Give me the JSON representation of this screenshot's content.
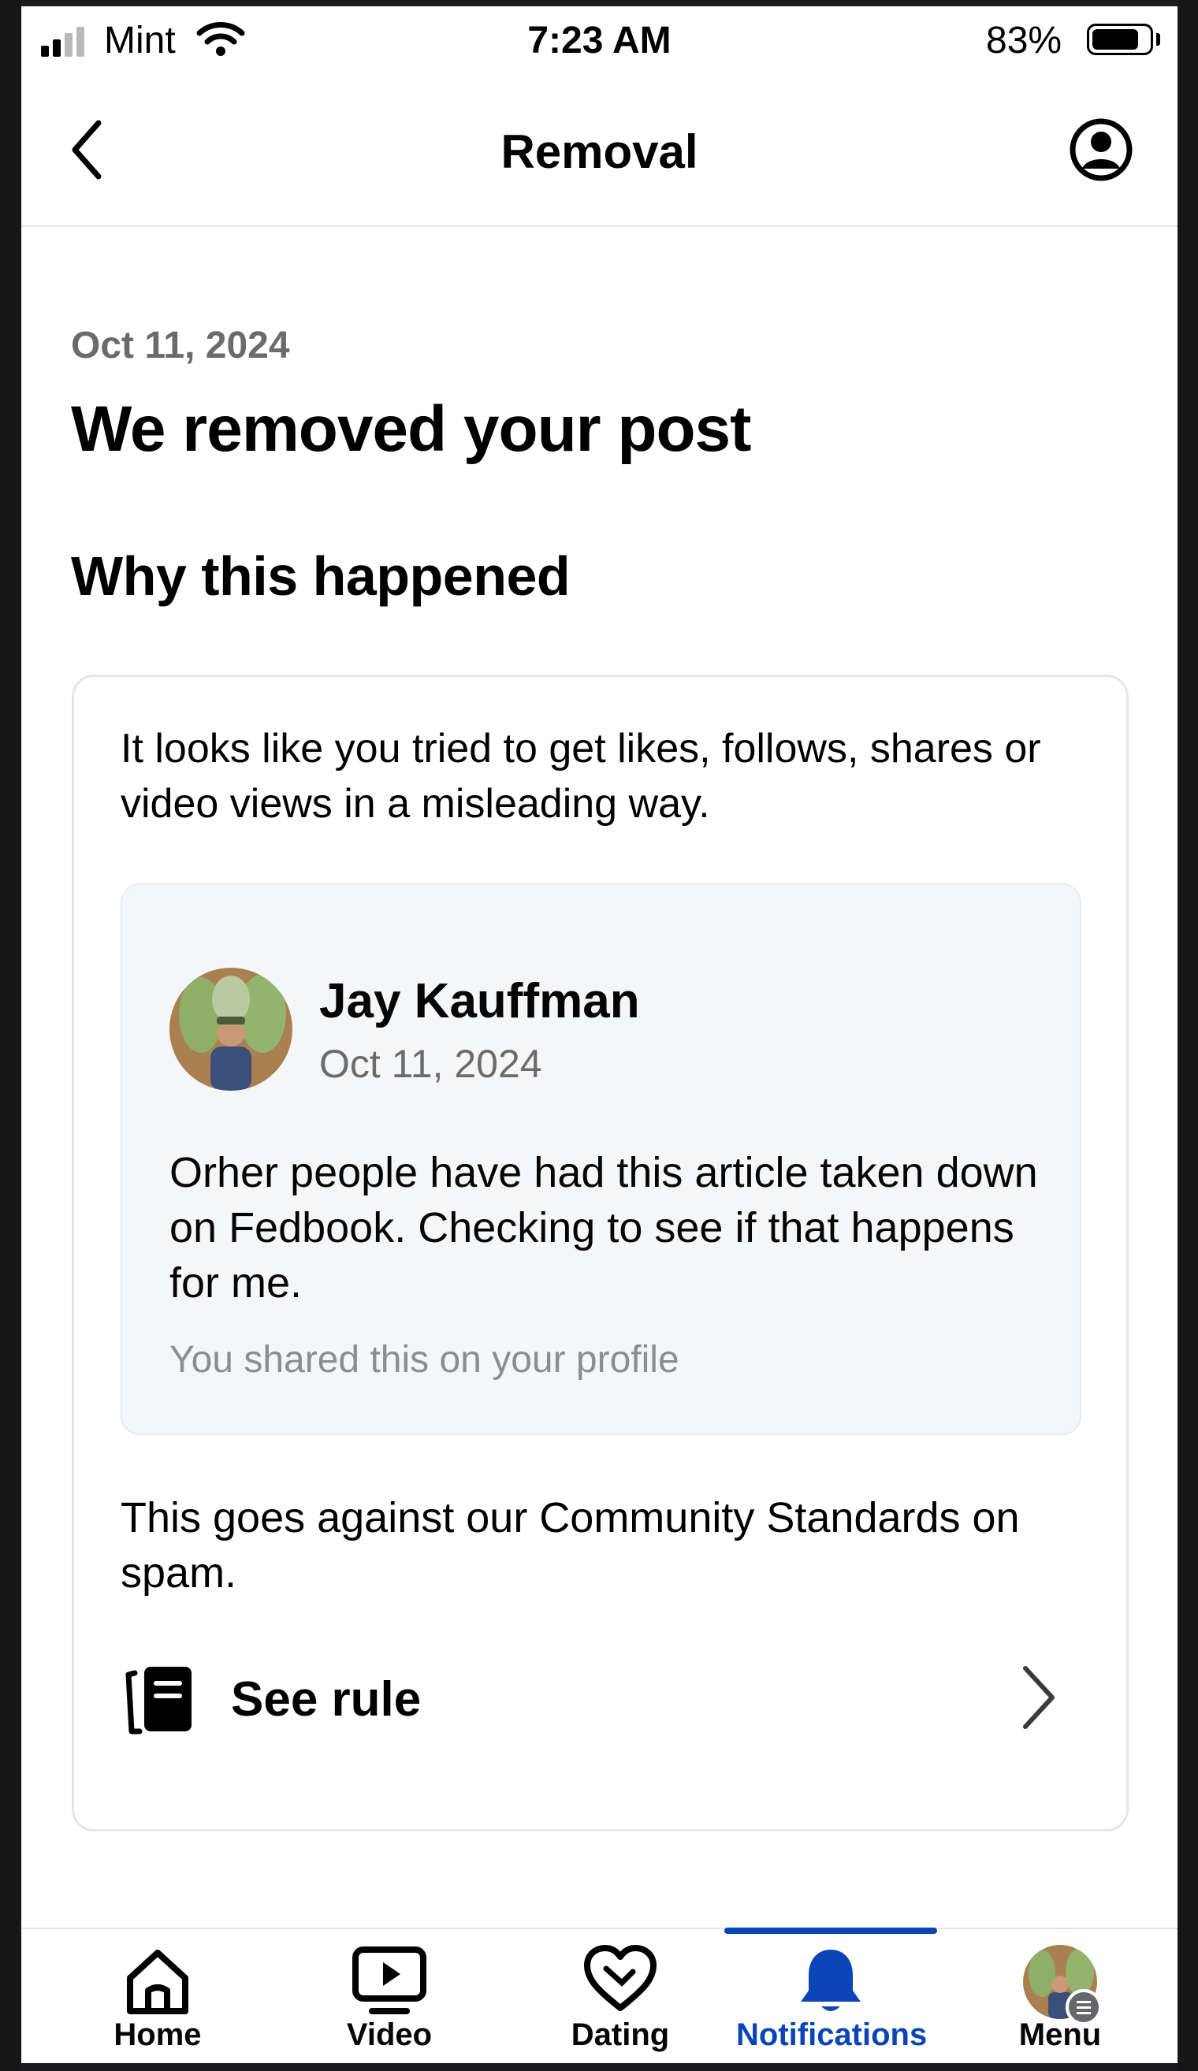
{
  "status_bar": {
    "carrier": "Mint",
    "time": "7:23 AM",
    "battery_percent": "83%",
    "battery_level": 0.83,
    "signal_bars": 2
  },
  "header": {
    "title": "Removal",
    "back_icon": "chevron-left-icon",
    "profile_icon": "user-circle-icon"
  },
  "notice": {
    "date": "Oct 11, 2024",
    "title": "We removed your post",
    "section_heading": "Why this happened",
    "reason": "It looks like you tried to get likes, follows, shares or video views in a misleading way.",
    "post": {
      "author": "Jay Kauffman",
      "date": "Oct 11, 2024",
      "text": "Orher people have had this article taken down on Fedbook. Checking to see if that happens for me.",
      "note": "You shared this on your profile"
    },
    "standards_text": "This goes against our Community Standards on spam.",
    "see_rule_label": "See rule",
    "see_rule_icon": "rulebook-icon"
  },
  "tabs": [
    {
      "label": "Home",
      "icon": "home-icon",
      "active": false
    },
    {
      "label": "Video",
      "icon": "video-icon",
      "active": false
    },
    {
      "label": "Dating",
      "icon": "heart-icon",
      "active": false
    },
    {
      "label": "Notifications",
      "icon": "bell-icon",
      "active": true
    },
    {
      "label": "Menu",
      "icon": "avatar-icon",
      "active": false
    }
  ],
  "colors": {
    "accent": "#0a46b8",
    "muted_text": "#6b6b6b",
    "card_border": "#e4e6eb",
    "post_background": "#f5f6f8"
  }
}
